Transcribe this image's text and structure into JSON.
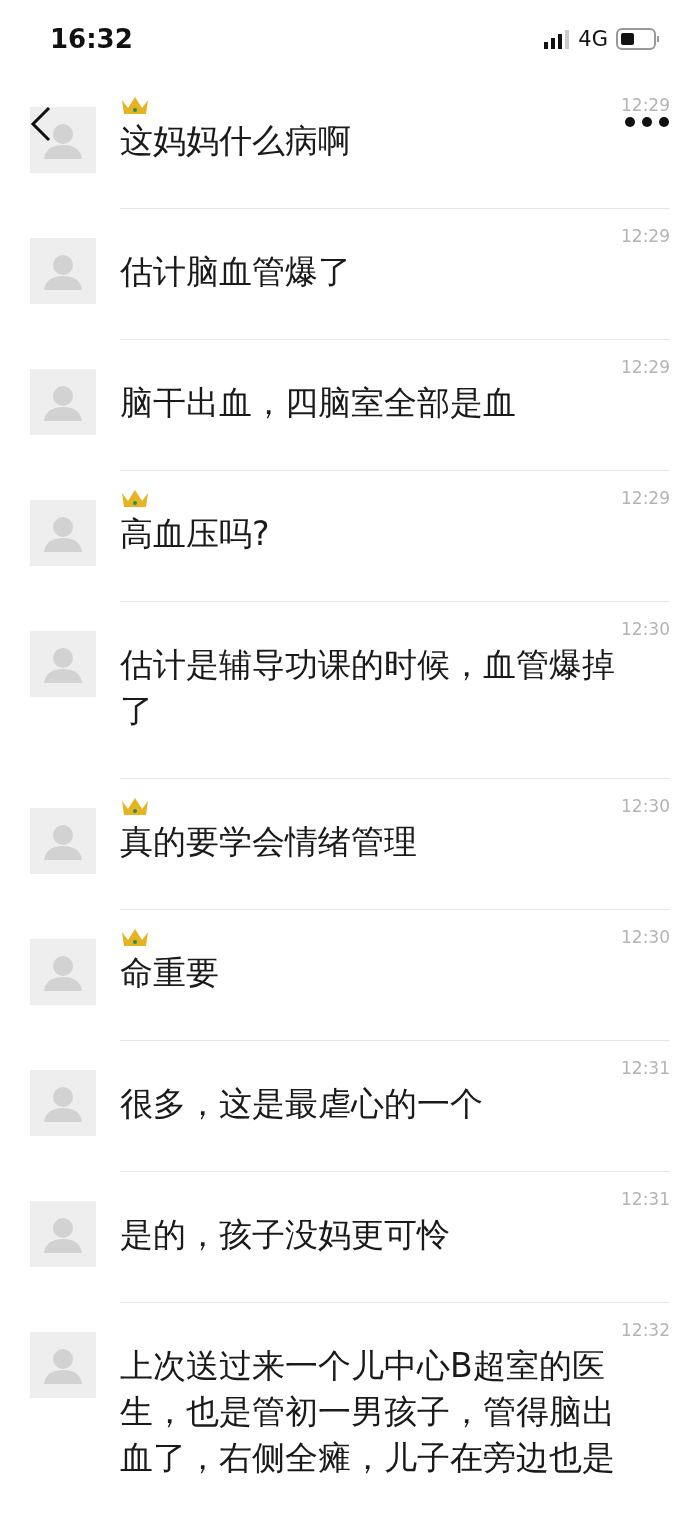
{
  "status_bar": {
    "time": "16:32",
    "network": "4G"
  },
  "messages": [
    {
      "crown": true,
      "time": "12:29",
      "text": "这妈妈什么病啊"
    },
    {
      "crown": false,
      "time": "12:29",
      "text": "估计脑血管爆了"
    },
    {
      "crown": false,
      "time": "12:29",
      "text": "脑干出血，四脑室全部是血"
    },
    {
      "crown": true,
      "time": "12:29",
      "text": "高血压吗?"
    },
    {
      "crown": false,
      "time": "12:30",
      "text": "估计是辅导功课的时候，血管爆掉了"
    },
    {
      "crown": true,
      "time": "12:30",
      "text": "真的要学会情绪管理"
    },
    {
      "crown": true,
      "time": "12:30",
      "text": "命重要"
    },
    {
      "crown": false,
      "time": "12:31",
      "text": "很多，这是最虐心的一个"
    },
    {
      "crown": false,
      "time": "12:31",
      "text": "是的，孩子没妈更可怜"
    },
    {
      "crown": false,
      "time": "12:32",
      "text": "上次送过来一个儿中心B超室的医生，也是管初一男孩子，管得脑出血了，右侧全瘫，儿子在旁边也是"
    }
  ]
}
